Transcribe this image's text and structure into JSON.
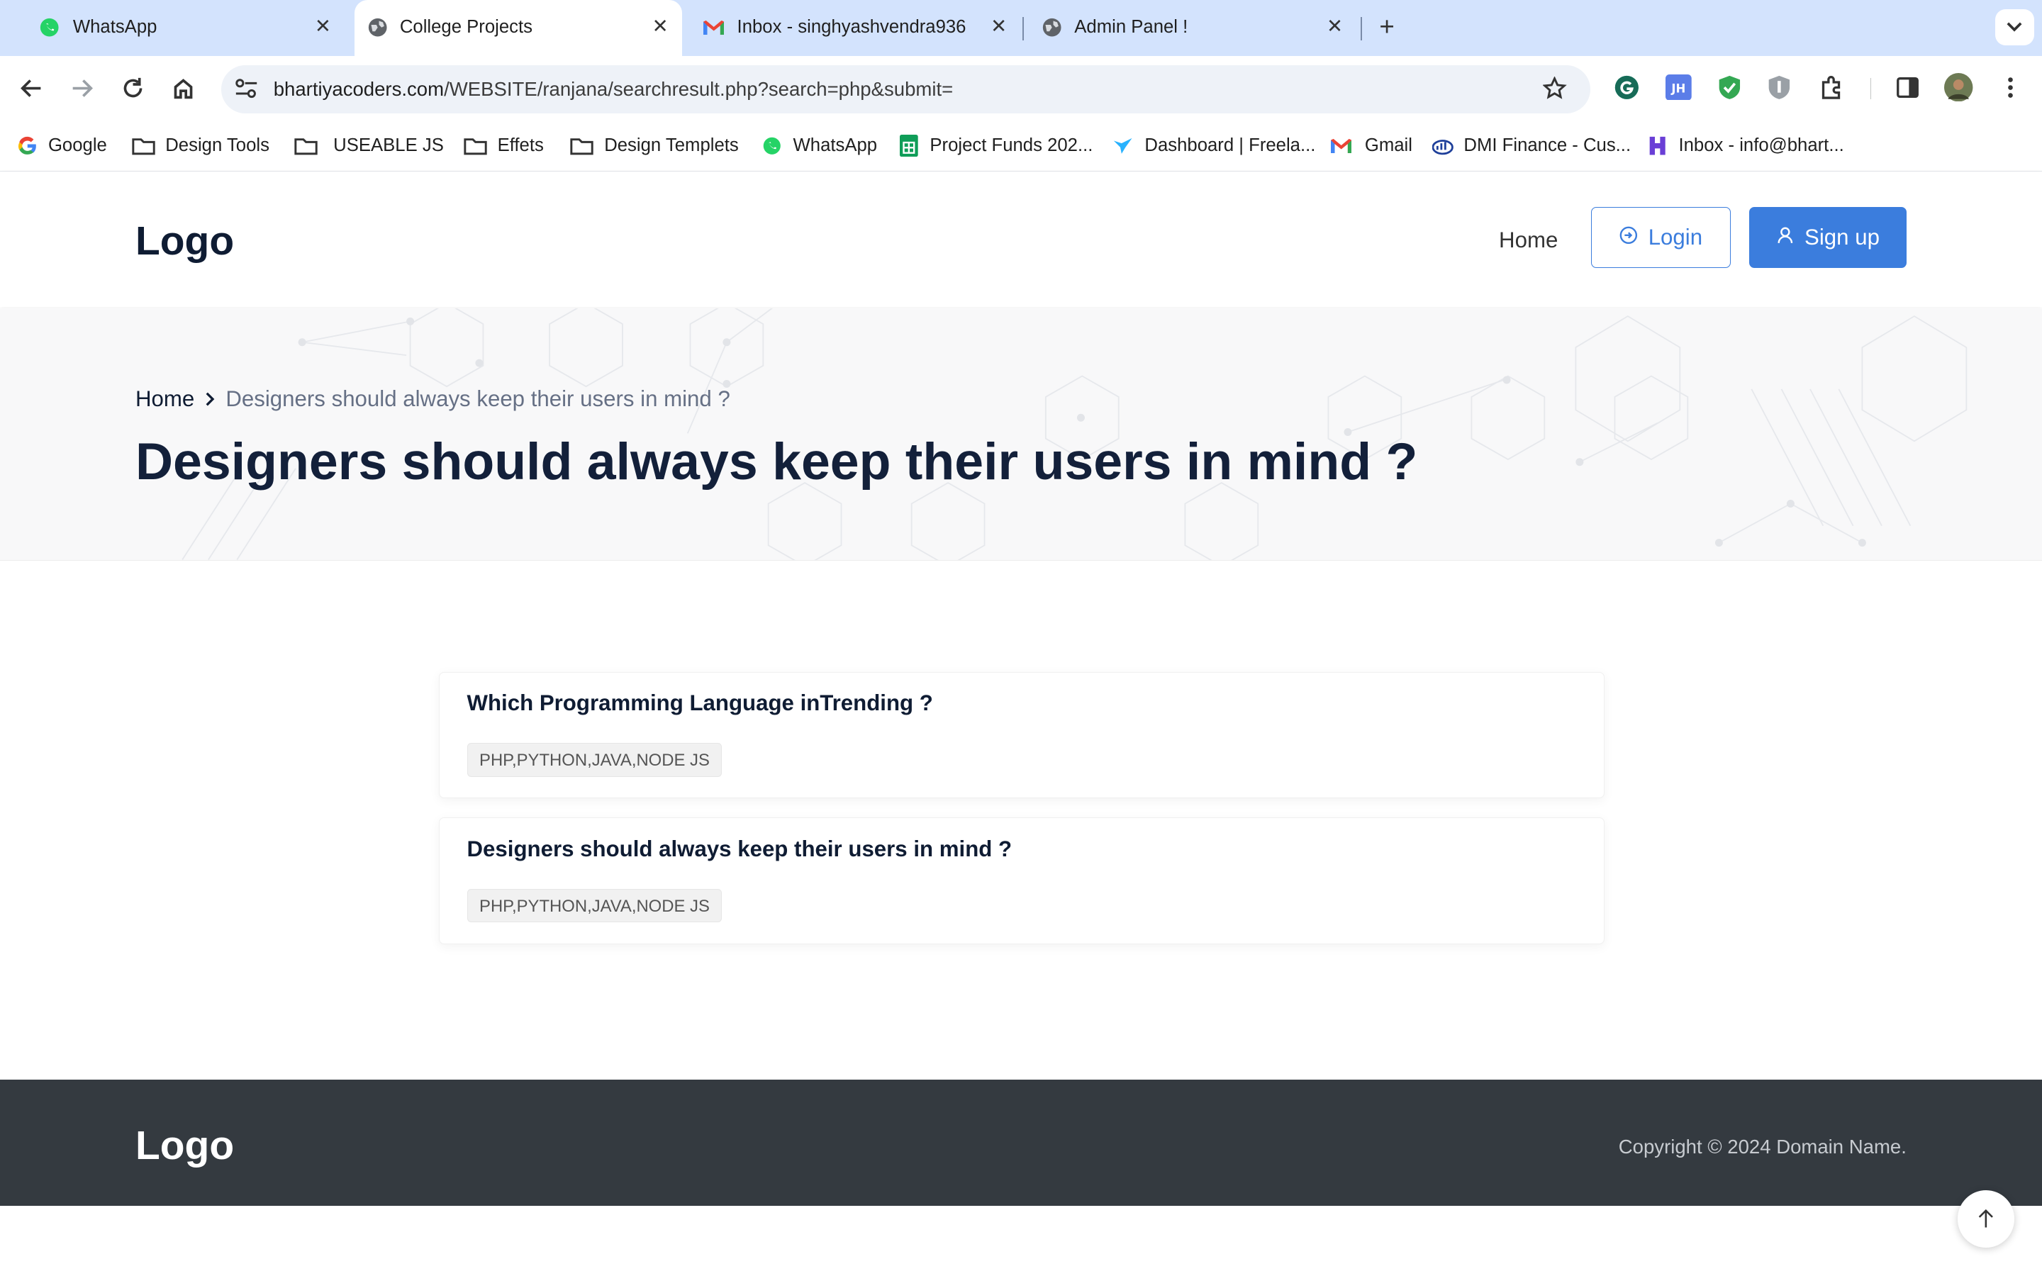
{
  "browser": {
    "tabs": [
      {
        "title": "WhatsApp",
        "icon": "whatsapp-icon",
        "active": false
      },
      {
        "title": "College Projects",
        "icon": "globe-icon",
        "active": true
      },
      {
        "title": "Inbox - singhyashvendra936",
        "icon": "gmail-icon",
        "active": false
      },
      {
        "title": "Admin Panel !",
        "icon": "globe-icon",
        "active": false
      }
    ],
    "url_host": "bhartiyacoders.com",
    "url_path": "/WEBSITE/ranjana/searchresult.php?search=php&submit=",
    "bookmarks": [
      {
        "label": "Google",
        "icon": "google-icon"
      },
      {
        "label": "Design Tools",
        "icon": "folder-icon"
      },
      {
        "label": "USEABLE JS",
        "icon": "folder-icon"
      },
      {
        "label": "Effets",
        "icon": "folder-icon"
      },
      {
        "label": "Design Templets",
        "icon": "folder-icon"
      },
      {
        "label": "WhatsApp",
        "icon": "whatsapp-icon"
      },
      {
        "label": "Project Funds 202...",
        "icon": "sheets-icon"
      },
      {
        "label": "Dashboard | Freela...",
        "icon": "bird-icon"
      },
      {
        "label": "Gmail",
        "icon": "gmail-icon"
      },
      {
        "label": "DMI Finance - Cus...",
        "icon": "finance-icon"
      },
      {
        "label": "Inbox - info@bhart...",
        "icon": "mail-h-icon"
      }
    ]
  },
  "header": {
    "logo": "Logo",
    "nav_home": "Home",
    "login_label": "Login",
    "signup_label": "Sign up"
  },
  "hero": {
    "breadcrumb_home": "Home",
    "breadcrumb_current": "Designers should always keep their users in mind ?",
    "title": "Designers should always keep their users in mind ?"
  },
  "results": [
    {
      "title": "Which Programming Language inTrending ?",
      "tags": "PHP,PYTHON,JAVA,NODE JS"
    },
    {
      "title": "Designers should always keep their users in mind ?",
      "tags": "PHP,PYTHON,JAVA,NODE JS"
    }
  ],
  "footer": {
    "logo": "Logo",
    "copyright": "Copyright © 2024 Domain Name."
  },
  "colors": {
    "primary": "#3b7ddd",
    "heading": "#0f1c33",
    "footer_bg": "#343a40"
  }
}
